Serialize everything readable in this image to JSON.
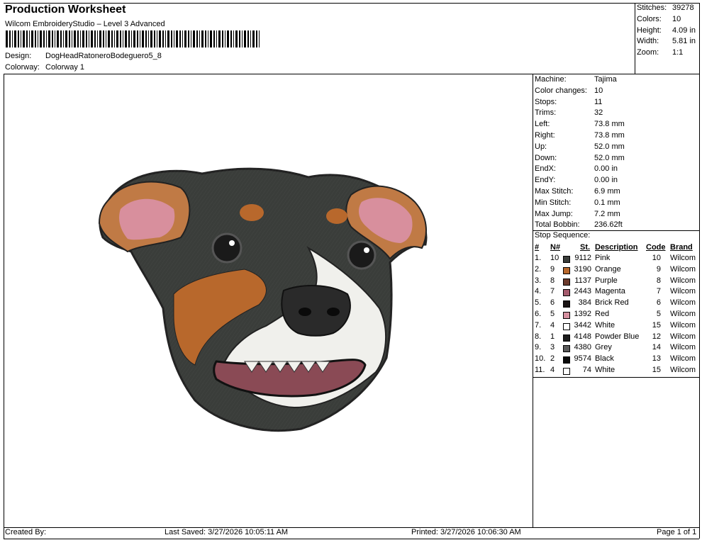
{
  "header": {
    "title": "Production Worksheet",
    "subtitle": "Wilcom EmbroideryStudio – Level 3 Advanced",
    "design_label": "Design:",
    "design_value": "DogHeadRatoneroBodeguero5_8",
    "colorway_label": "Colorway:",
    "colorway_value": "Colorway 1"
  },
  "summary": {
    "stitches_label": "Stitches:",
    "stitches_value": "39278",
    "colors_label": "Colors:",
    "colors_value": "10",
    "height_label": "Height:",
    "height_value": "4.09 in",
    "width_label": "Width:",
    "width_value": "5.81 in",
    "zoom_label": "Zoom:",
    "zoom_value": "1:1"
  },
  "machine_info": [
    {
      "label": "Machine:",
      "value": "Tajima"
    },
    {
      "label": "Color changes:",
      "value": "10"
    },
    {
      "label": "Stops:",
      "value": "11"
    },
    {
      "label": "Trims:",
      "value": "32"
    },
    {
      "label": "Left:",
      "value": "73.8 mm"
    },
    {
      "label": "Right:",
      "value": "73.8 mm"
    },
    {
      "label": "Up:",
      "value": "52.0 mm"
    },
    {
      "label": "Down:",
      "value": "52.0 mm"
    },
    {
      "label": "EndX:",
      "value": "0.00 in"
    },
    {
      "label": "EndY:",
      "value": "0.00 in"
    },
    {
      "label": "Max Stitch:",
      "value": "6.9 mm"
    },
    {
      "label": "Min Stitch:",
      "value": "0.1 mm"
    },
    {
      "label": "Max Jump:",
      "value": "7.2 mm"
    },
    {
      "label": "Total Bobbin:",
      "value": "236.62ft"
    }
  ],
  "stop_sequence": {
    "title": "Stop Sequence:",
    "headers": {
      "num": "#",
      "n": "N#",
      "st": "St.",
      "desc": "Description",
      "code": "Code",
      "brand": "Brand"
    },
    "rows": [
      {
        "idx": "1.",
        "n": "10",
        "color": "#3a3d3a",
        "st": "9112",
        "desc": "Pink",
        "code": "10",
        "brand": "Wilcom"
      },
      {
        "idx": "2.",
        "n": "9",
        "color": "#b8682c",
        "st": "3190",
        "desc": "Orange",
        "code": "9",
        "brand": "Wilcom"
      },
      {
        "idx": "3.",
        "n": "8",
        "color": "#6b3a2c",
        "st": "1137",
        "desc": "Purple",
        "code": "8",
        "brand": "Wilcom"
      },
      {
        "idx": "4.",
        "n": "7",
        "color": "#a45a6c",
        "st": "2443",
        "desc": "Magenta",
        "code": "7",
        "brand": "Wilcom"
      },
      {
        "idx": "5.",
        "n": "6",
        "color": "#1a1414",
        "st": "384",
        "desc": "Brick Red",
        "code": "6",
        "brand": "Wilcom"
      },
      {
        "idx": "6.",
        "n": "5",
        "color": "#d690a0",
        "st": "1392",
        "desc": "Red",
        "code": "5",
        "brand": "Wilcom"
      },
      {
        "idx": "7.",
        "n": "4",
        "color": "#ffffff",
        "st": "3442",
        "desc": "White",
        "code": "15",
        "brand": "Wilcom"
      },
      {
        "idx": "8.",
        "n": "1",
        "color": "#1c1c1c",
        "st": "4148",
        "desc": "Powder Blue",
        "code": "12",
        "brand": "Wilcom"
      },
      {
        "idx": "9.",
        "n": "3",
        "color": "#5a5a5a",
        "st": "4380",
        "desc": "Grey",
        "code": "14",
        "brand": "Wilcom"
      },
      {
        "idx": "10.",
        "n": "2",
        "color": "#0a0a0a",
        "st": "9574",
        "desc": "Black",
        "code": "13",
        "brand": "Wilcom"
      },
      {
        "idx": "11.",
        "n": "4",
        "color": "#ffffff",
        "st": "74",
        "desc": "White",
        "code": "15",
        "brand": "Wilcom"
      }
    ]
  },
  "footer": {
    "created_by": "Created By:",
    "last_saved": "Last Saved: 3/27/2026 10:05:11 AM",
    "printed": "Printed: 3/27/2026 10:06:30 AM",
    "page": "Page 1 of 1"
  }
}
